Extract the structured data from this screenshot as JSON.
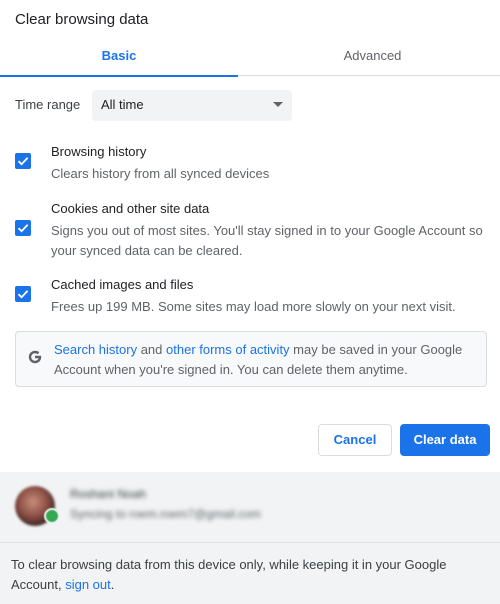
{
  "dialog": {
    "title": "Clear browsing data"
  },
  "tabs": {
    "basic": "Basic",
    "advanced": "Advanced",
    "active": "Basic"
  },
  "time_range": {
    "label": "Time range",
    "value": "All time"
  },
  "options": [
    {
      "title": "Browsing history",
      "description": "Clears history from all synced devices",
      "checked": true
    },
    {
      "title": "Cookies and other site data",
      "description": "Signs you out of most sites. You'll stay signed in to your Google Account so your synced data can be cleared.",
      "checked": true
    },
    {
      "title": "Cached images and files",
      "description": "Frees up 199 MB. Some sites may load more slowly on your next visit.",
      "checked": true
    }
  ],
  "info": {
    "icon": "google-g-icon",
    "link1": "Search history",
    "text1": " and ",
    "link2": "other forms of activity",
    "text2": " may be saved in your Google Account when you're signed in. You can delete them anytime."
  },
  "buttons": {
    "cancel": "Cancel",
    "clear": "Clear data"
  },
  "account": {
    "name": "Roshani Noah",
    "status": "Syncing to roem.roem7@gmail.com",
    "badge_icon": "sync-icon"
  },
  "footer": {
    "text": "To clear browsing data from this device only, while keeping it in your Google Account, ",
    "link": "sign out",
    "end": "."
  },
  "colors": {
    "accent": "#1a73e8",
    "text": "#202124",
    "secondary_text": "#5f6368",
    "footer_bg": "#f1f3f4"
  }
}
